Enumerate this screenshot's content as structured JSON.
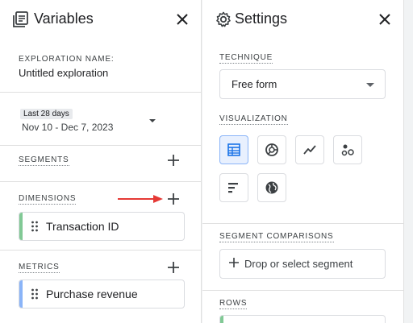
{
  "variables": {
    "title": "Variables",
    "exploration_name_label": "EXPLORATION NAME:",
    "exploration_name": "Untitled exploration",
    "date_range_label": "Last 28 days",
    "date_range": "Nov 10 - Dec 7, 2023",
    "segments_label": "SEGMENTS",
    "dimensions_label": "DIMENSIONS",
    "dimensions": [
      {
        "label": "Transaction ID",
        "color": "#81c995"
      }
    ],
    "metrics_label": "METRICS",
    "metrics": [
      {
        "label": "Purchase revenue",
        "color": "#8ab4f8"
      }
    ],
    "annotation_arrow_color": "#e53935"
  },
  "settings": {
    "title": "Settings",
    "technique_label": "TECHNIQUE",
    "technique_value": "Free form",
    "visualization_label": "VISUALIZATION",
    "visualizations": [
      {
        "icon": "table-icon",
        "selected": true
      },
      {
        "icon": "donut-chart-icon",
        "selected": false
      },
      {
        "icon": "line-chart-icon",
        "selected": false
      },
      {
        "icon": "scatter-plot-icon",
        "selected": false
      },
      {
        "icon": "bar-chart-icon",
        "selected": false
      },
      {
        "icon": "geo-map-icon",
        "selected": false
      }
    ],
    "segment_comparisons_label": "SEGMENT COMPARISONS",
    "segment_drop_text": "Drop or select segment",
    "rows_label": "ROWS"
  }
}
